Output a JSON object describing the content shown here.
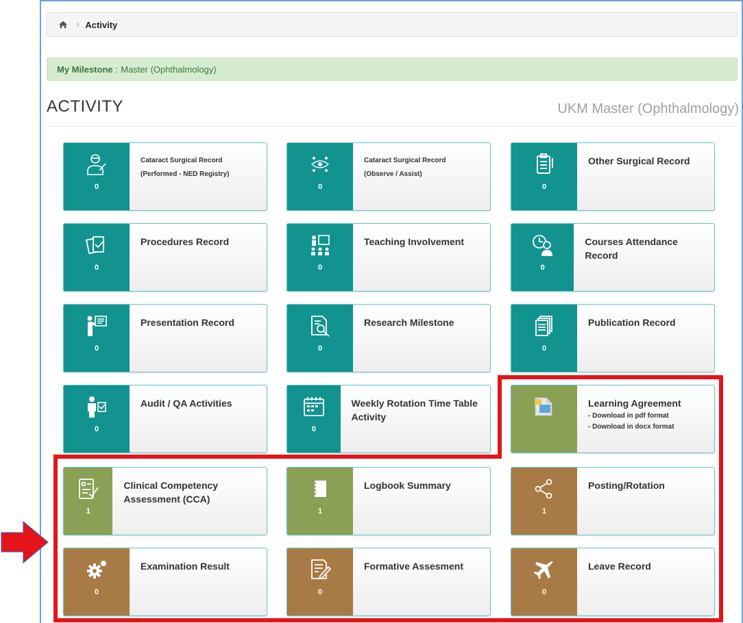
{
  "breadcrumb": {
    "home_icon": "home-icon",
    "current": "Activity"
  },
  "milestone": {
    "label": "My Milestone",
    "separator": ":",
    "value": "Master (Ophthalmology)"
  },
  "page": {
    "title": "ACTIVITY",
    "program": "UKM Master (Ophthalmology)"
  },
  "colors": {
    "teal": "#12938f",
    "olive": "#8aa055",
    "brown": "#a87a45",
    "highlight": "#e3151a",
    "arrow": "#e3151a"
  },
  "tiles": [
    {
      "label": "Cataract Surgical Record",
      "sub": "(Performed - NED Registry)",
      "count": "0",
      "icon": "surgeon-icon",
      "color": "teal"
    },
    {
      "label": "Cataract Surgical Record",
      "sub": "(Observe / Assist)",
      "count": "0",
      "icon": "eye-scatter-icon",
      "color": "teal"
    },
    {
      "label": "Other Surgical Record",
      "count": "0",
      "icon": "clipboard-icon",
      "color": "teal"
    },
    {
      "label": "Procedures Record",
      "count": "0",
      "icon": "documents-check-icon",
      "color": "teal"
    },
    {
      "label": "Teaching Involvement",
      "count": "0",
      "icon": "teacher-board-icon",
      "color": "teal"
    },
    {
      "label": "Courses Attendance Record",
      "count": "0",
      "icon": "clock-person-icon",
      "color": "teal"
    },
    {
      "label": "Presentation Record",
      "count": "0",
      "icon": "presenter-icon",
      "color": "teal"
    },
    {
      "label": "Research Milestone",
      "count": "0",
      "icon": "document-search-icon",
      "color": "teal"
    },
    {
      "label": "Publication Record",
      "count": "0",
      "icon": "pages-stack-icon",
      "color": "teal"
    },
    {
      "label": "Audit / QA Activities",
      "count": "0",
      "icon": "person-checklist-icon",
      "color": "teal"
    },
    {
      "label": "Weekly Rotation Time Table Activity",
      "count": "0",
      "icon": "calendar-icon",
      "color": "teal"
    },
    {
      "label": "Learning Agreement",
      "sub1": "- Download in pdf format",
      "sub2": "- Download in docx format",
      "icon": "file-folder-icon",
      "color": "olive"
    },
    {
      "label": "Clinical Competency Assessment (CCA)",
      "count": "1",
      "icon": "assessment-form-icon",
      "color": "olive"
    },
    {
      "label": "Logbook Summary",
      "count": "1",
      "icon": "notebook-icon",
      "color": "olive"
    },
    {
      "label": "Posting/Rotation",
      "count": "1",
      "icon": "share-nodes-icon",
      "color": "brown"
    },
    {
      "label": "Examination Result",
      "count": "0",
      "icon": "gears-icon",
      "color": "brown"
    },
    {
      "label": "Formative Assesment",
      "count": "0",
      "icon": "edit-document-icon",
      "color": "brown"
    },
    {
      "label": "Leave Record",
      "count": "0",
      "icon": "airplane-icon",
      "color": "brown"
    }
  ]
}
